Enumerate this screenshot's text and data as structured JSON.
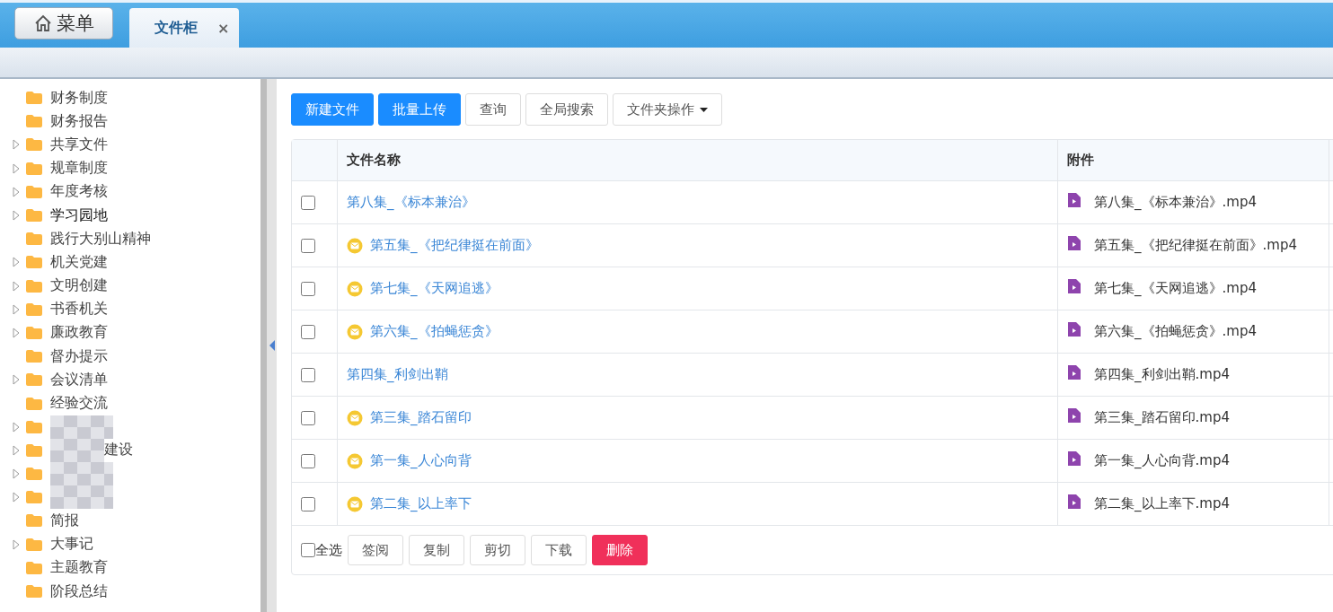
{
  "menu_button": {
    "label": "菜单"
  },
  "tabs": [
    {
      "label": "文件柜",
      "selected": true,
      "close": "×"
    }
  ],
  "sidebar": {
    "items": [
      {
        "label": "财务制度",
        "has_children": false,
        "selected": false
      },
      {
        "label": "财务报告",
        "has_children": false,
        "selected": false
      },
      {
        "label": "共享文件",
        "has_children": true,
        "selected": false
      },
      {
        "label": "规章制度",
        "has_children": true,
        "selected": false
      },
      {
        "label": "年度考核",
        "has_children": true,
        "selected": false
      },
      {
        "label": "学习园地",
        "has_children": true,
        "selected": true
      },
      {
        "label": "践行大别山精神",
        "has_children": false,
        "selected": false
      },
      {
        "label": "机关党建",
        "has_children": true,
        "selected": false
      },
      {
        "label": "文明创建",
        "has_children": true,
        "selected": false
      },
      {
        "label": "书香机关",
        "has_children": true,
        "selected": false
      },
      {
        "label": "廉政教育",
        "has_children": true,
        "selected": false
      },
      {
        "label": "督办提示",
        "has_children": false,
        "selected": false
      },
      {
        "label": "会议清单",
        "has_children": true,
        "selected": false
      },
      {
        "label": "经验交流",
        "has_children": false,
        "selected": false
      },
      {
        "obscured": true,
        "has_children": true
      },
      {
        "label": "建设",
        "obscured": true,
        "has_children": true,
        "selected": false
      },
      {
        "obscured": true,
        "has_children": true
      },
      {
        "obscured": true,
        "has_children": true
      },
      {
        "label": "简报",
        "has_children": false,
        "selected": false
      },
      {
        "label": "大事记",
        "has_children": true,
        "selected": false
      },
      {
        "label": "主题教育",
        "has_children": false,
        "selected": false
      },
      {
        "label": "阶段总结",
        "has_children": false,
        "selected": false
      }
    ]
  },
  "toolbar": [
    {
      "label": "新建文件",
      "kind": "primary"
    },
    {
      "label": "批量上传",
      "kind": "primary"
    },
    {
      "label": "查询",
      "kind": "plain"
    },
    {
      "label": "全局搜索",
      "kind": "plain"
    },
    {
      "label": "文件夹操作",
      "kind": "dropdown"
    }
  ],
  "table": {
    "columns": [
      "文件名称",
      "附件"
    ],
    "rows": [
      {
        "checked": false,
        "unread": false,
        "name": "第八集_《标本兼治》",
        "attachment": "第八集_《标本兼治》.mp4"
      },
      {
        "checked": false,
        "unread": true,
        "name": "第五集_《把纪律挺在前面》",
        "attachment": "第五集_《把纪律挺在前面》.mp4"
      },
      {
        "checked": false,
        "unread": true,
        "name": "第七集_《天网追逃》",
        "attachment": "第七集_《天网追逃》.mp4"
      },
      {
        "checked": false,
        "unread": true,
        "name": "第六集_《拍蝇惩贪》",
        "attachment": "第六集_《拍蝇惩贪》.mp4"
      },
      {
        "checked": false,
        "unread": false,
        "name": "第四集_利剑出鞘",
        "attachment": "第四集_利剑出鞘.mp4"
      },
      {
        "checked": false,
        "unread": true,
        "name": "第三集_踏石留印",
        "attachment": "第三集_踏石留印.mp4"
      },
      {
        "checked": false,
        "unread": true,
        "name": "第一集_人心向背",
        "attachment": "第一集_人心向背.mp4"
      },
      {
        "checked": false,
        "unread": true,
        "name": "第二集_以上率下",
        "attachment": "第二集_以上率下.mp4"
      }
    ]
  },
  "footer": {
    "select_all": {
      "label": "全选",
      "checked": false
    },
    "buttons": [
      {
        "label": "签阅",
        "kind": "plain"
      },
      {
        "label": "复制",
        "kind": "plain"
      },
      {
        "label": "剪切",
        "kind": "plain"
      },
      {
        "label": "下载",
        "kind": "plain"
      },
      {
        "label": "删除",
        "kind": "danger"
      }
    ]
  }
}
